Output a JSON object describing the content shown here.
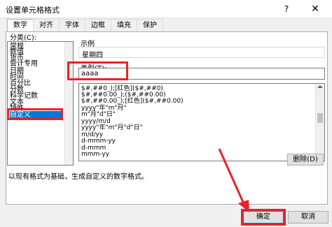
{
  "window": {
    "title": "设置单元格格式",
    "help": "?",
    "close": "✕"
  },
  "tabs": [
    "数字",
    "对齐",
    "字体",
    "边框",
    "填充",
    "保护"
  ],
  "category": {
    "label": "分类(C):",
    "items": [
      "常规",
      "数值",
      "货币",
      "会计专用",
      "日期",
      "时间",
      "百分比",
      "分数",
      "科学记数",
      "文本",
      "特殊",
      "自定义"
    ],
    "selected": "自定义"
  },
  "sample": {
    "label": "示例",
    "value": "星期四"
  },
  "type": {
    "label": "类型(T):",
    "value": "aaaa"
  },
  "formats": [
    "$#,##0_);[红色]($#,##0)",
    "$#,##0.00_);($#,##0.00)",
    "$#,##0.00_);[红色]($#,##0.00)",
    "yyyy\"年\"m\"月\"",
    "m\"月\"d\"日\"",
    "yyyy/m/d",
    "yyyy\"年\"m\"月\"d\"日\"",
    "m/d/yy",
    "d-mmm-yy",
    "d-mmm",
    "mmm-yy"
  ],
  "buttons": {
    "delete": "删除(D)",
    "ok": "确定",
    "cancel": "取消"
  },
  "description": "以现有格式为基础，生成自定义的数字格式。",
  "colors": {
    "highlight": "#e8222a",
    "selection": "#0078d7"
  }
}
